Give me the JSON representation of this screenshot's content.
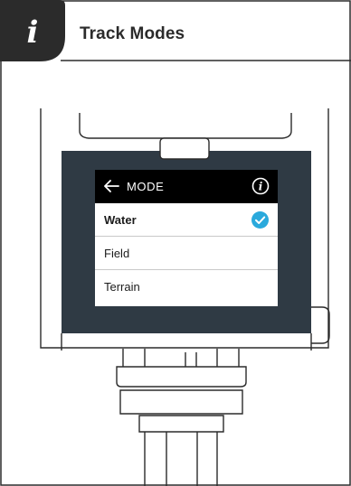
{
  "header": {
    "title": "Track Modes",
    "badge_icon": "info-icon",
    "badge_color": "#2b2b2b"
  },
  "device_screen": {
    "title": "MODE",
    "back_icon": "back-arrow-icon",
    "info_icon": "info-circle-icon",
    "header_color": "#000000",
    "modes": [
      {
        "label": "Water",
        "selected": true
      },
      {
        "label": "Field",
        "selected": false
      },
      {
        "label": "Terrain",
        "selected": false
      }
    ],
    "check_icon": "check-circle-icon",
    "check_color": "#2aa9dc"
  },
  "device_body_color": "#2f3a44"
}
